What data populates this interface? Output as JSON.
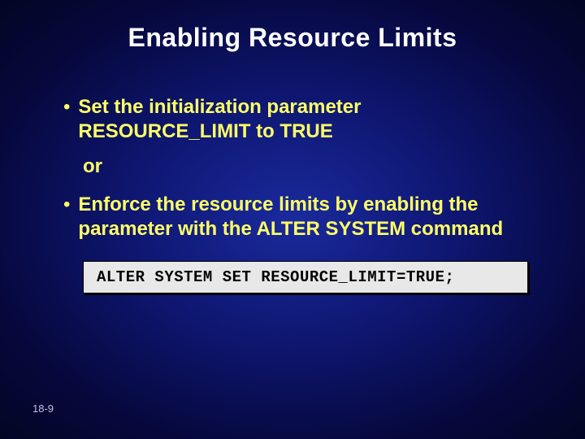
{
  "slide": {
    "title": "Enabling Resource Limits",
    "bullets": [
      "Set the initialization parameter RESOURCE_LIMIT to TRUE",
      "Enforce the resource limits by enabling the parameter with the ALTER SYSTEM command"
    ],
    "or_label": "or",
    "code": "ALTER SYSTEM SET RESOURCE_LIMIT=TRUE;",
    "page": "18-9"
  },
  "chart_data": null
}
